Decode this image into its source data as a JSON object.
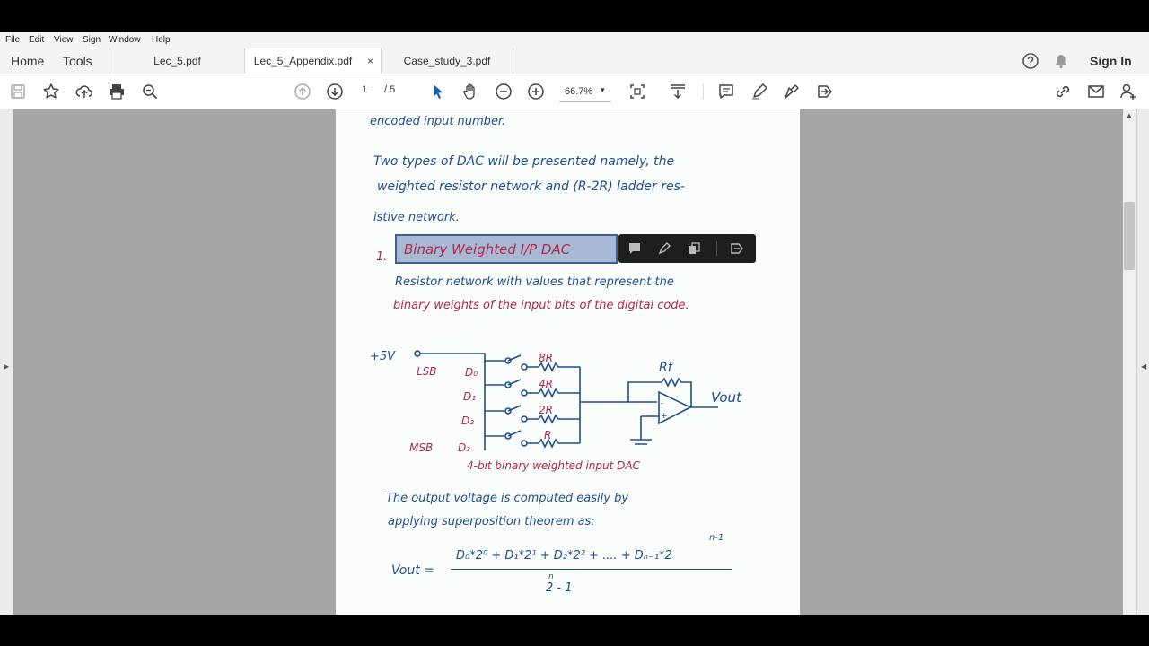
{
  "menu": [
    "File",
    "Edit",
    "View",
    "Sign",
    "Window",
    "Help"
  ],
  "nav": {
    "home": "Home",
    "tools": "Tools",
    "sign_in": "Sign In"
  },
  "tabs": [
    {
      "label": "Lec_5.pdf",
      "active": false
    },
    {
      "label": "Lec_5_Appendix.pdf",
      "active": true,
      "close": "×"
    },
    {
      "label": "Case_study_3.pdf",
      "active": false
    }
  ],
  "toolbar": {
    "page_current": "1",
    "page_total": "/ 5",
    "zoom": "66.7%",
    "zoom_caret": "▾"
  },
  "document": {
    "lines": [
      "encoded input number.",
      "Two types of DAC will be presented namely, the",
      "weighted resistor network and (R-2R) ladder res-",
      "istive network.",
      "1.",
      "Binary Weighted I/P DAC",
      "Resistor network with values that represent the",
      "binary weights of the input bits of the digital code.",
      "4-bit binary weighted input DAC",
      "The output voltage is computed easily by",
      "applying superposition theorem as:"
    ],
    "circuit": {
      "supply": "+5V",
      "lsb": "LSB",
      "msb": "MSB",
      "inputs": [
        "D₀",
        "D₁",
        "D₂",
        "D₃"
      ],
      "resistors": [
        "8R",
        "4R",
        "2R",
        "R"
      ],
      "feedback": "Rf",
      "output": "Vout",
      "opamp_minus": "-",
      "opamp_plus": "+"
    },
    "formula": {
      "lhs": "Vout =",
      "numerator": "D₀*2⁰ + D₁*2¹ + D₂*2² + .... + Dₙ₋₁*2",
      "exponent": "n-1",
      "denominator": "2 - 1",
      "den_exponent": "n"
    }
  },
  "colors": {
    "ink_blue": "#1f4f8f",
    "ink_red": "#b0284a",
    "highlight": "#a7b9d4",
    "workspace": "#a6a6a6"
  }
}
